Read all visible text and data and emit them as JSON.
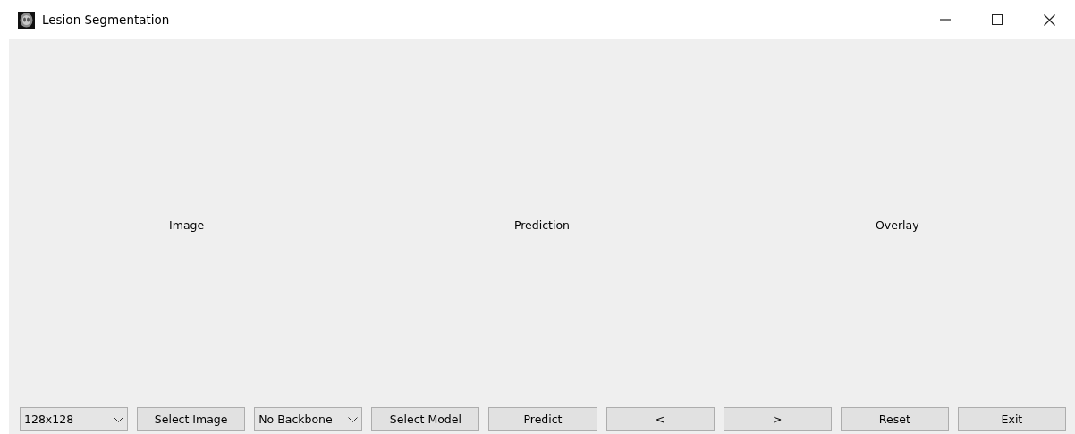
{
  "window": {
    "title": "Lesion Segmentation"
  },
  "panels": [
    {
      "label": "Image"
    },
    {
      "label": "Prediction"
    },
    {
      "label": "Overlay"
    }
  ],
  "controls": [
    {
      "kind": "combo",
      "value": "128x128"
    },
    {
      "kind": "button",
      "label": "Select Image"
    },
    {
      "kind": "combo",
      "value": "No Backbone"
    },
    {
      "kind": "button",
      "label": "Select Model"
    },
    {
      "kind": "button",
      "label": "Predict"
    },
    {
      "kind": "button",
      "label": "<"
    },
    {
      "kind": "button",
      "label": ">"
    },
    {
      "kind": "button",
      "label": "Reset"
    },
    {
      "kind": "button",
      "label": "Exit"
    }
  ]
}
